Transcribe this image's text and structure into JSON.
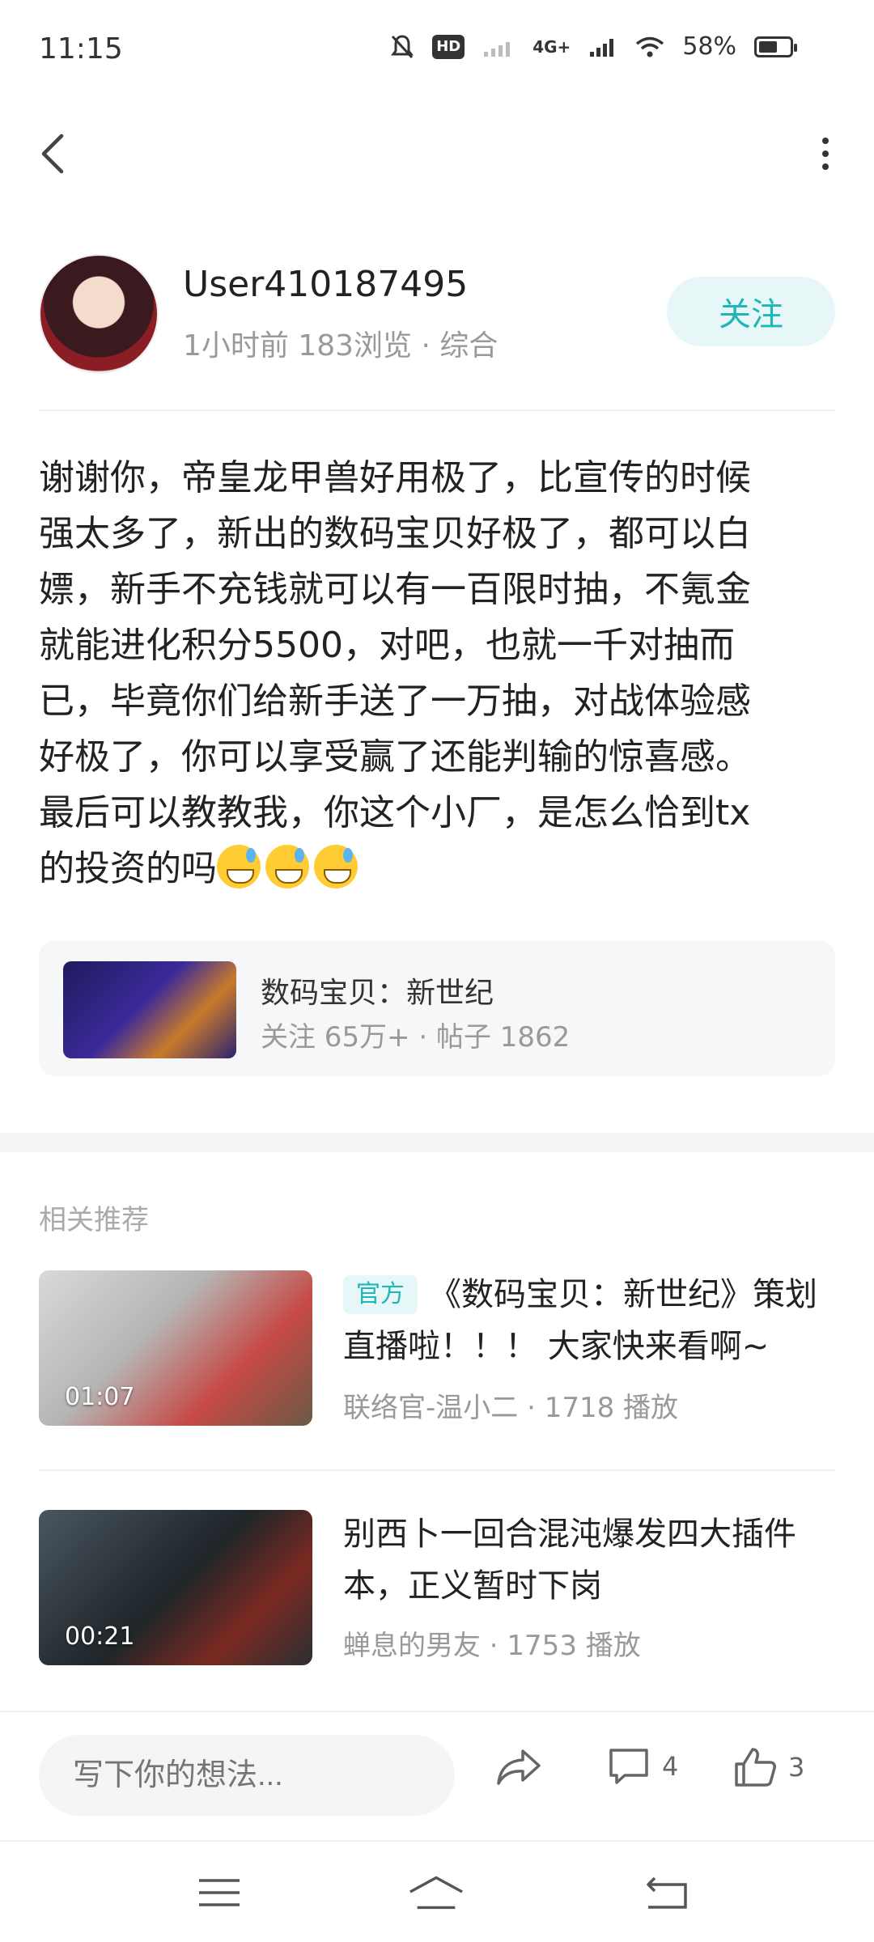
{
  "status_bar": {
    "time": "11:15",
    "battery": "58%",
    "battery_level": 0.58,
    "hd_label": "HD",
    "network": "4G+"
  },
  "header": {
    "back_icon": "chevron-left-icon",
    "more_icon": "more-vertical-icon"
  },
  "author": {
    "name": "User410187495",
    "meta": "1小时前  183浏览 · 综合",
    "follow_label": "关注"
  },
  "post": {
    "lines": [
      "谢谢你，帝皇龙甲兽好用极了，比宣传的时候",
      "强太多了，新出的数码宝贝好极了，都可以白",
      "嫖，新手不充钱就可以有一百限时抽，不氪金",
      "就能进化积分5500，对吧，也就一千对抽而",
      "已，毕竟你们给新手送了一万抽，对战体验感",
      "好极了，你可以享受赢了还能判输的惊喜感。",
      "最后可以教教我，你这个小厂，是怎么恰到tx",
      "的投资的吗"
    ],
    "emoji_count": 3
  },
  "topic": {
    "name": "数码宝贝：新世纪",
    "meta": "关注 65万+ · 帖子 1862"
  },
  "related": {
    "label": "相关推荐",
    "items": [
      {
        "tag": "官方",
        "title": "《数码宝贝：新世纪》策划直播啦！！！ 大家快来看啊~",
        "duration": "01:07",
        "meta": "联络官-温小二 · 1718 播放"
      },
      {
        "tag": "",
        "title": "别西卜一回合混沌爆发四大插件本，正义暂时下岗",
        "duration": "00:21",
        "meta": "蝉息的男友 · 1753 播放"
      }
    ]
  },
  "action_bar": {
    "input_placeholder": "写下你的想法...",
    "comment_count": "4",
    "like_count": "3"
  },
  "colors": {
    "accent": "#1fb7b5",
    "accent_bg": "#e7f7f7"
  }
}
